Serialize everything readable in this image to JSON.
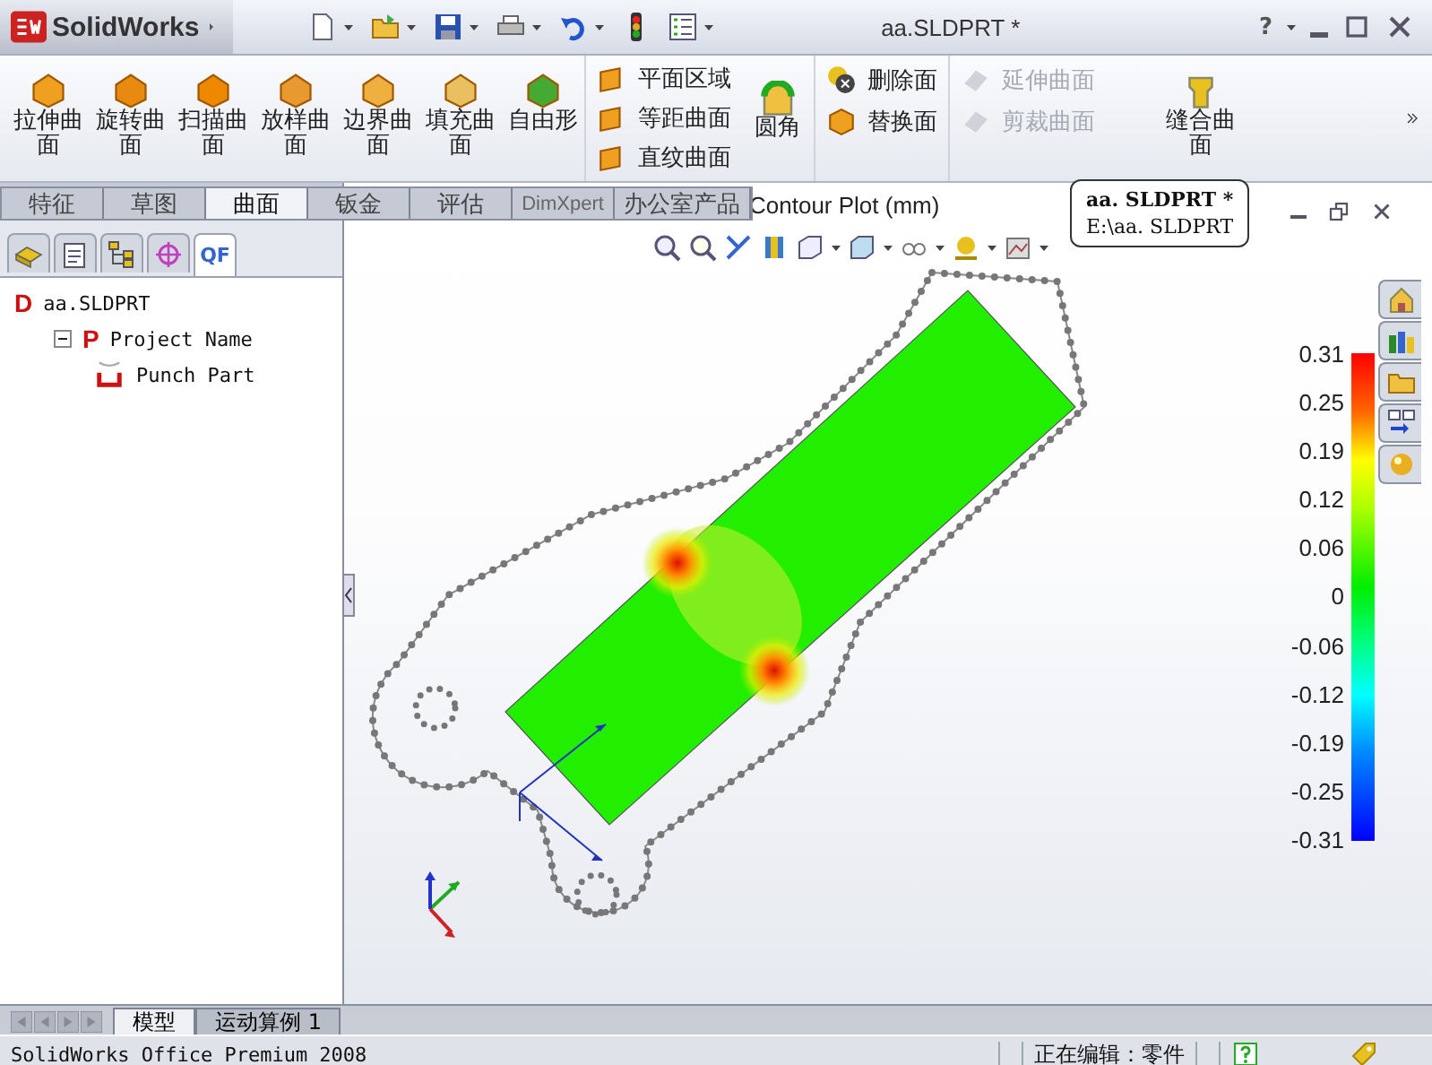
{
  "app": {
    "logo": "SolidWorks",
    "title": "aa.SLDPRT *",
    "help": "?"
  },
  "ribbon": {
    "large": [
      {
        "label": "拉伸曲面"
      },
      {
        "label": "旋转曲面"
      },
      {
        "label": "扫描曲面"
      },
      {
        "label": "放样曲面"
      },
      {
        "label": "边界曲面"
      },
      {
        "label": "填充曲面"
      },
      {
        "label": "自由形"
      }
    ],
    "stack1": [
      {
        "label": "平面区域"
      },
      {
        "label": "等距曲面"
      },
      {
        "label": "直纹曲面"
      }
    ],
    "fillet": "圆角",
    "stack2": [
      {
        "label": "删除面"
      },
      {
        "label": "替换面"
      }
    ],
    "stack3": [
      {
        "label": "延伸曲面",
        "disabled": true
      },
      {
        "label": "剪裁曲面",
        "disabled": true
      }
    ],
    "knit": "缝合曲面"
  },
  "command_tabs": [
    {
      "label": "特征",
      "selected": false
    },
    {
      "label": "草图",
      "selected": false
    },
    {
      "label": "曲面",
      "selected": true
    },
    {
      "label": "钣金",
      "selected": false
    },
    {
      "label": "评估",
      "selected": false
    },
    {
      "label": "DimXpert",
      "selected": false
    },
    {
      "label": "办公室产品",
      "selected": false
    }
  ],
  "tooltip": {
    "title": "aa. SLDPRT *",
    "path": "E:\\aa. SLDPRT"
  },
  "feature_tabs": [
    {
      "kind": "parts",
      "selected": false
    },
    {
      "kind": "properties",
      "selected": false
    },
    {
      "kind": "config",
      "selected": false
    },
    {
      "kind": "target",
      "selected": false
    },
    {
      "kind": "text",
      "label": "QF",
      "selected": true
    }
  ],
  "tree": [
    {
      "marker": "D",
      "label": "aa.SLDPRT",
      "children": [
        {
          "marker": "P",
          "label": "Project Name",
          "expanded": true,
          "children": [
            {
              "label": "Punch Part"
            }
          ]
        }
      ]
    }
  ],
  "viewport": {
    "title": "Contour Plot (mm)",
    "legend": [
      "0.31",
      "0.25",
      "0.19",
      "0.12",
      "0.06",
      "0",
      "-0.06",
      "-0.12",
      "-0.19",
      "-0.25",
      "-0.31"
    ]
  },
  "bottom_tabs": [
    {
      "label": "模型",
      "selected": true
    },
    {
      "label": "运动算例 1",
      "selected": false
    }
  ],
  "status_bar": {
    "product": "SolidWorks Office Premium 2008",
    "mode": "正在编辑：零件"
  }
}
